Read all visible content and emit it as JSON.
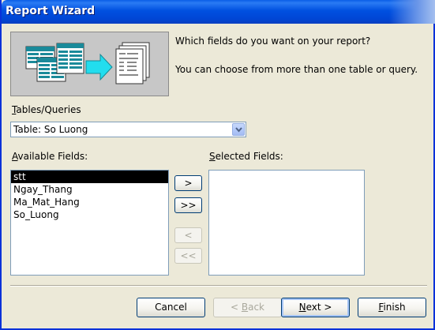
{
  "window": {
    "title": "Report Wizard"
  },
  "header": {
    "prompt_line1": "Which fields do you want on your report?",
    "prompt_line2": "You can choose from more than one table or query."
  },
  "tables": {
    "label_mnemonic": "T",
    "label_rest": "ables/Queries",
    "selected_value": "Table: So Luong"
  },
  "available": {
    "label_mnemonic": "A",
    "label_rest": "vailable Fields:",
    "items": [
      {
        "label": "stt",
        "selected": true
      },
      {
        "label": "Ngay_Thang",
        "selected": false
      },
      {
        "label": "Ma_Mat_Hang",
        "selected": false
      },
      {
        "label": "So_Luong",
        "selected": false
      }
    ]
  },
  "selected": {
    "label_prefix": "",
    "label_mnemonic": "S",
    "label_rest": "elected Fields:",
    "items": []
  },
  "move_buttons": {
    "add_one": ">",
    "add_all": ">>",
    "remove_one": "<",
    "remove_all": "<<"
  },
  "footer": {
    "cancel": "Cancel",
    "back_prefix": "< ",
    "back_mnemonic": "B",
    "back_rest": "ack",
    "next_mnemonic": "N",
    "next_rest": "ext >",
    "finish_mnemonic": "F",
    "finish_rest": "inish"
  },
  "colors": {
    "titlebar": "#0050e0",
    "dialog_bg": "#ece9d8",
    "selection": "#000000"
  }
}
